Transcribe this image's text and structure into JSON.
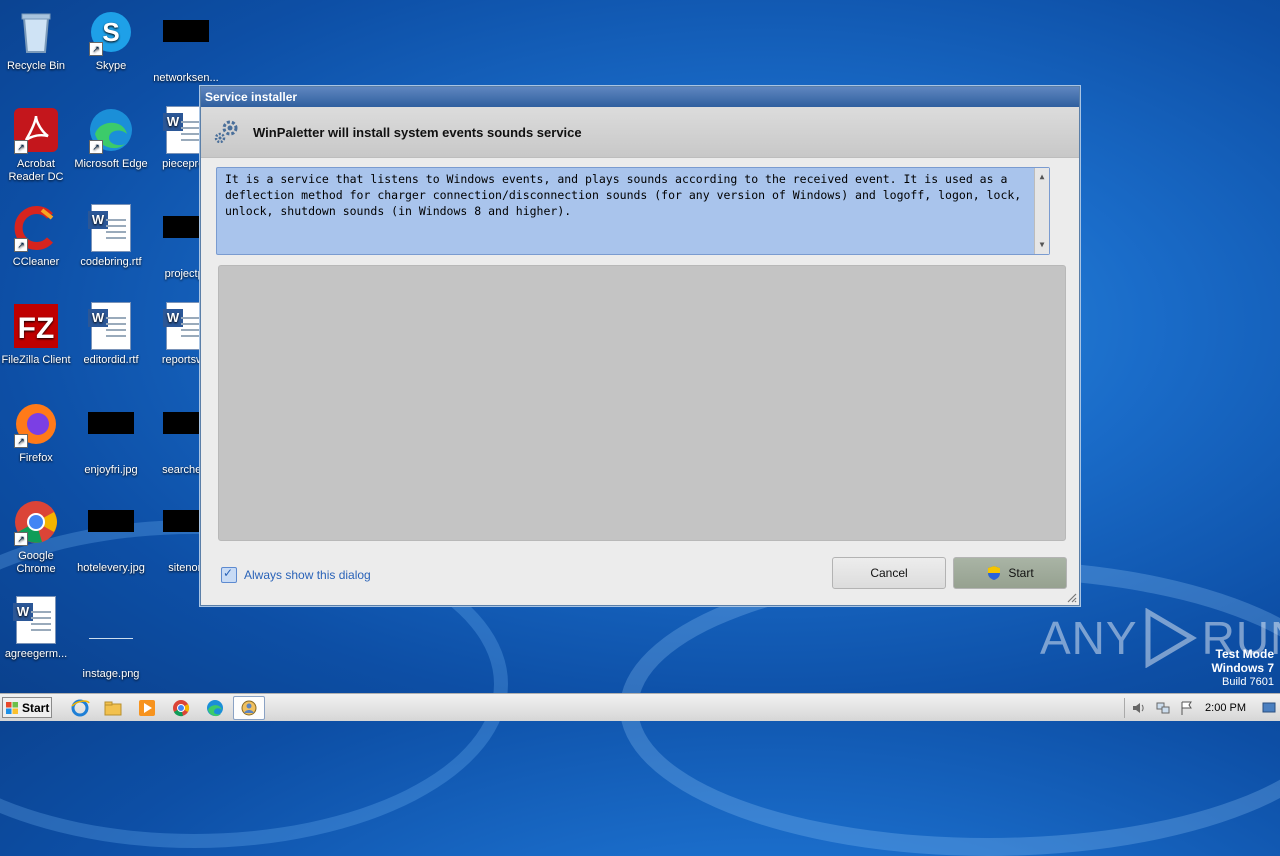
{
  "desktop": {
    "icons": [
      {
        "label": "Recycle Bin"
      },
      {
        "label": "Skype"
      },
      {
        "label": "networksen..."
      },
      {
        "label": "Acrobat Reader DC"
      },
      {
        "label": "Microsoft Edge"
      },
      {
        "label": "piecepres"
      },
      {
        "label": "CCleaner"
      },
      {
        "label": "codebring.rtf"
      },
      {
        "label": "projectpr"
      },
      {
        "label": "FileZilla Client"
      },
      {
        "label": "editordid.rtf"
      },
      {
        "label": "reportswo"
      },
      {
        "label": "Firefox"
      },
      {
        "label": "enjoyfri.jpg"
      },
      {
        "label": "searchesf"
      },
      {
        "label": "Google Chrome"
      },
      {
        "label": "hotelevery.jpg"
      },
      {
        "label": "sitenon"
      },
      {
        "label": "agreegerm..."
      },
      {
        "label": "instage.png"
      }
    ]
  },
  "dialog": {
    "window_title": "Service installer",
    "header_title": "WinPaletter will install system events sounds service",
    "description": "It is a service that listens to Windows events, and plays sounds according to the received event. It is used as a deflection method for charger connection/disconnection sounds (for any version of Windows) and logoff, logon, lock, unlock, shutdown sounds (in Windows 8 and higher).",
    "always_show_label": "Always show this dialog",
    "always_show_checked": true,
    "cancel_label": "Cancel",
    "start_label": "Start"
  },
  "watermark": {
    "left": "ANY",
    "right": "RUN",
    "test_mode": "Test Mode",
    "os": "Windows 7",
    "build": "Build 7601"
  },
  "taskbar": {
    "start_label": "Start",
    "clock": "2:00 PM",
    "pinned": [
      "ie-icon",
      "explorer-icon",
      "media-player-icon",
      "chrome-icon",
      "edge-icon",
      "winpaletter-icon"
    ]
  },
  "colors": {
    "accent": "#2a63b8",
    "desc_bg": "#a9c4ec",
    "start_button": "#9ea99a"
  }
}
